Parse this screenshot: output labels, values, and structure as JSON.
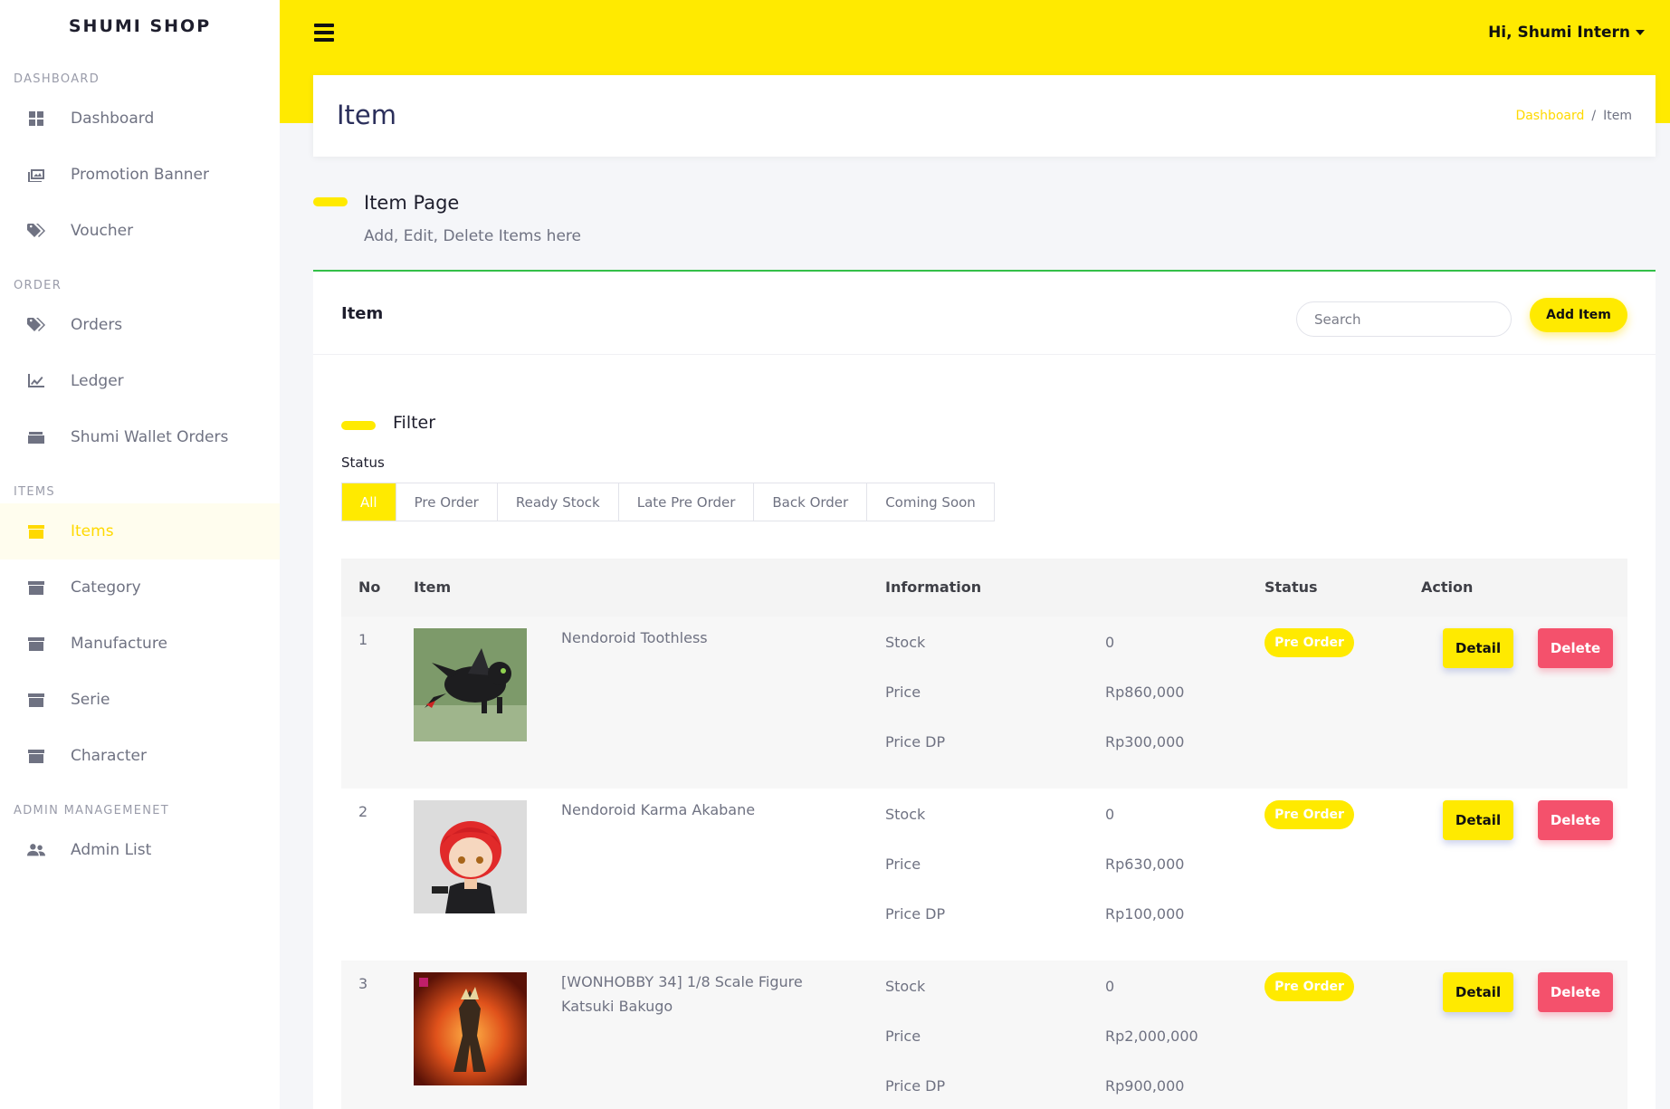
{
  "brand": "SHUMI SHOP",
  "sidebar": {
    "sections": [
      {
        "heading": "DASHBOARD",
        "items": [
          {
            "label": "Dashboard",
            "icon": "grid-icon"
          },
          {
            "label": "Promotion Banner",
            "icon": "image-icon"
          },
          {
            "label": "Voucher",
            "icon": "tags-icon"
          }
        ]
      },
      {
        "heading": "ORDER",
        "items": [
          {
            "label": "Orders",
            "icon": "tags-icon"
          },
          {
            "label": "Ledger",
            "icon": "chart-line-icon"
          },
          {
            "label": "Shumi Wallet Orders",
            "icon": "wallet-icon"
          }
        ]
      },
      {
        "heading": "ITEMS",
        "items": [
          {
            "label": "Items",
            "icon": "archive-icon",
            "active": true
          },
          {
            "label": "Category",
            "icon": "archive-icon"
          },
          {
            "label": "Manufacture",
            "icon": "archive-icon"
          },
          {
            "label": "Serie",
            "icon": "archive-icon"
          },
          {
            "label": "Character",
            "icon": "archive-icon"
          }
        ]
      },
      {
        "heading": "ADMIN MANAGEMENET",
        "items": [
          {
            "label": "Admin List",
            "icon": "users-icon"
          }
        ]
      }
    ]
  },
  "header": {
    "user_greeting": "Hi, Shumi Intern",
    "accent": "#ffea00"
  },
  "page": {
    "title": "Item",
    "breadcrumb": {
      "home": "Dashboard",
      "separator": "/",
      "current": "Item"
    },
    "section_title": "Item Page",
    "section_subtitle": "Add, Edit, Delete Items here"
  },
  "card": {
    "title": "Item",
    "search_placeholder": "Search",
    "add_button": "Add Item",
    "filter_title": "Filter",
    "status_label": "Status",
    "status_options": [
      "All",
      "Pre Order",
      "Ready Stock",
      "Late Pre Order",
      "Back Order",
      "Coming Soon"
    ],
    "status_selected": "All"
  },
  "table": {
    "columns": {
      "no": "No",
      "item": "Item",
      "information": "Information",
      "status": "Status",
      "action": "Action"
    },
    "info_labels": {
      "stock": "Stock",
      "price": "Price",
      "price_dp": "Price DP"
    },
    "rows": [
      {
        "no": "1",
        "name_lines": [
          "Nendoroid Toothless"
        ],
        "stock": "0",
        "price": "Rp860,000",
        "price_dp": "Rp300,000",
        "status": "Pre Order",
        "detail": "Detail",
        "delete": "Delete"
      },
      {
        "no": "2",
        "name_lines": [
          "Nendoroid Karma Akabane"
        ],
        "stock": "0",
        "price": "Rp630,000",
        "price_dp": "Rp100,000",
        "status": "Pre Order",
        "detail": "Detail",
        "delete": "Delete"
      },
      {
        "no": "3",
        "name_lines": [
          "[WONHOBBY 34] 1/8 Scale Figure",
          "Katsuki Bakugo"
        ],
        "stock": "0",
        "price": "Rp2,000,000",
        "price_dp": "Rp900,000",
        "status": "Pre Order",
        "detail": "Detail",
        "delete": "Delete"
      }
    ]
  }
}
